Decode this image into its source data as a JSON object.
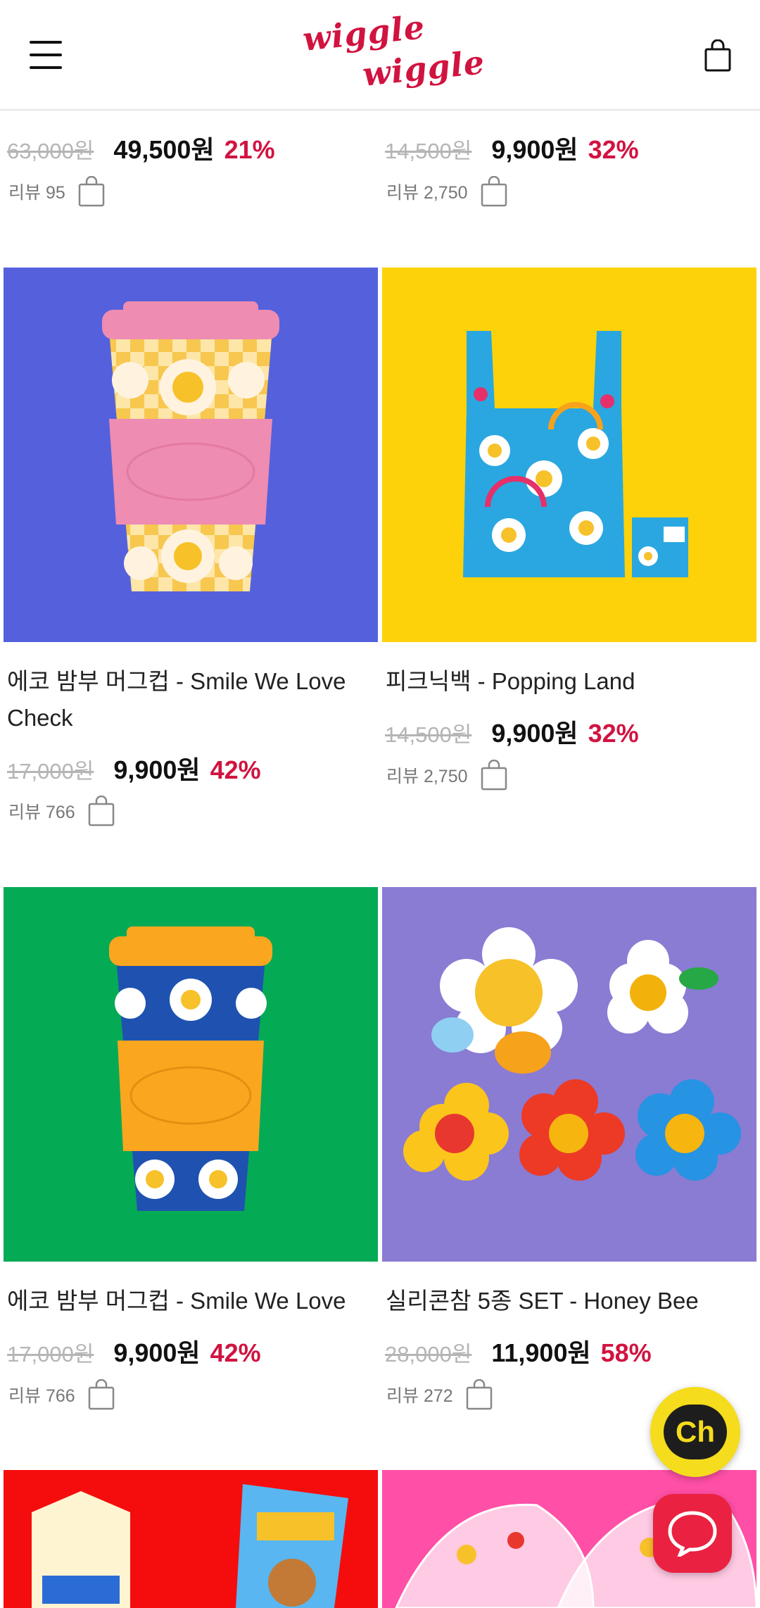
{
  "header": {
    "logo_line1": "wiggle",
    "logo_line2": "wiggle",
    "menu_icon": "hamburger-menu-icon",
    "cart_icon": "shopping-bag-icon"
  },
  "colors": {
    "brand": "#d11340",
    "discount": "#d11340",
    "old_price": "#b5b5b5",
    "kakao_yellow": "#f5dc1c",
    "chat_red": "#ea2140"
  },
  "products_top_partial": [
    {
      "old_price": "63,000원",
      "price": "49,500원",
      "discount": "21%",
      "reviews": "리뷰 95"
    },
    {
      "old_price": "14,500원",
      "price": "9,900원",
      "discount": "32%",
      "reviews": "리뷰 2,750"
    }
  ],
  "products": [
    {
      "title": "에코 밤부 머그컵 - Smile We Love Check",
      "old_price": "17,000원",
      "price": "9,900원",
      "discount": "42%",
      "reviews": "리뷰 766",
      "bg_color": "#5561dc"
    },
    {
      "title": "피크닉백 - Popping Land",
      "old_price": "14,500원",
      "price": "9,900원",
      "discount": "32%",
      "reviews": "리뷰 2,750",
      "bg_color": "#fdd20a"
    },
    {
      "title": "에코 밤부 머그컵 - Smile We Love",
      "old_price": "17,000원",
      "price": "9,900원",
      "discount": "42%",
      "reviews": "리뷰 766",
      "bg_color": "#05aa55"
    },
    {
      "title": "실리콘참 5종 SET - Honey Bee",
      "old_price": "28,000원",
      "price": "11,900원",
      "discount": "58%",
      "reviews": "리뷰 272",
      "bg_color": "#8a7bd3"
    }
  ],
  "products_bottom_partial": [
    {
      "bg_color": "#f50d0d"
    },
    {
      "bg_color": "#ff4fa6"
    }
  ],
  "floating": {
    "channel_label": "Ch",
    "channel_icon": "kakao-channel-icon",
    "chat_icon": "chat-bubble-icon"
  }
}
